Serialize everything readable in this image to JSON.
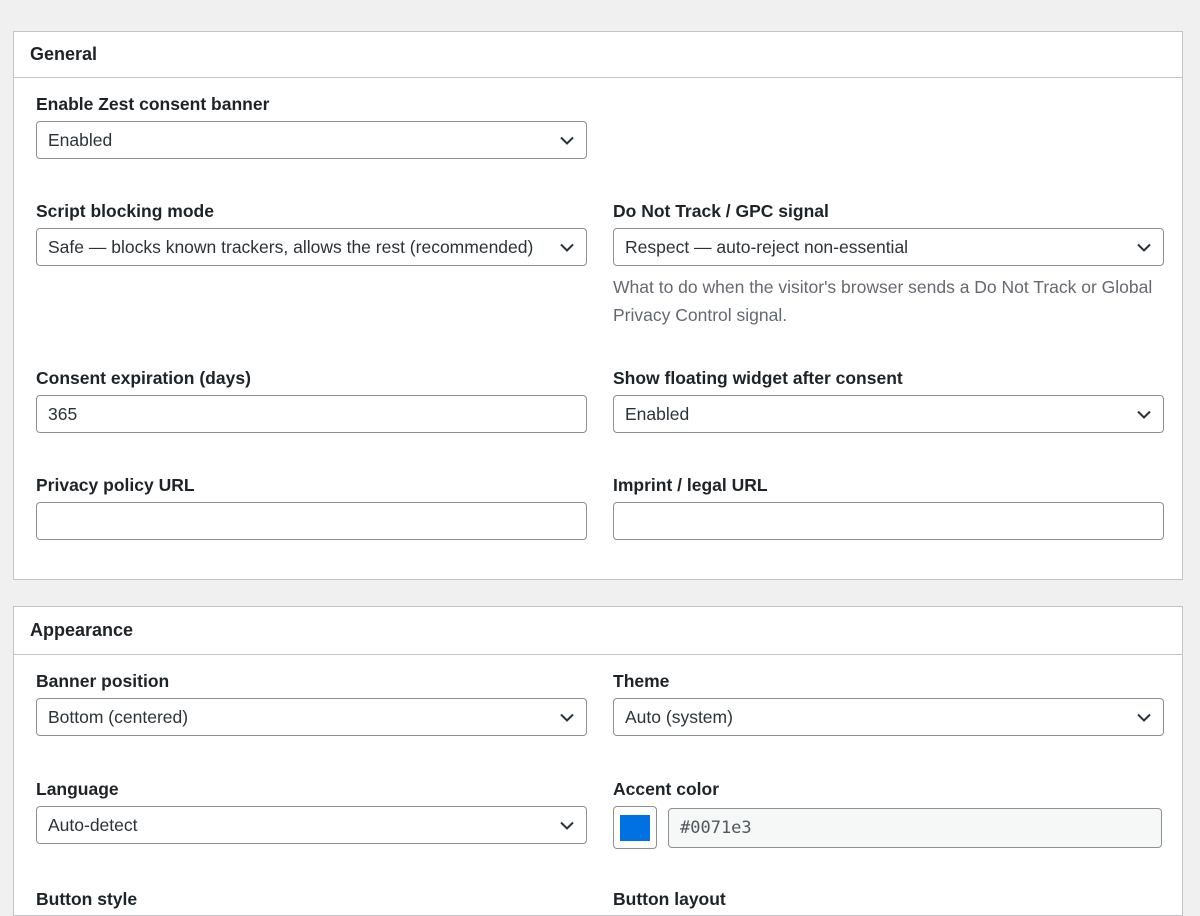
{
  "sections": {
    "general": {
      "title": "General",
      "fields": {
        "enable_banner": {
          "label": "Enable Zest consent banner",
          "value": "Enabled"
        },
        "script_blocking": {
          "label": "Script blocking mode",
          "value": "Safe — blocks known trackers, allows the rest (recommended)"
        },
        "dnt": {
          "label": "Do Not Track / GPC signal",
          "value": "Respect — auto-reject non-essential",
          "help": "What to do when the visitor's browser sends a Do Not Track or Global Privacy Control signal."
        },
        "expiration": {
          "label": "Consent expiration (days)",
          "value": "365"
        },
        "floating_widget": {
          "label": "Show floating widget after consent",
          "value": "Enabled"
        },
        "privacy_url": {
          "label": "Privacy policy URL",
          "value": ""
        },
        "imprint_url": {
          "label": "Imprint / legal URL",
          "value": ""
        }
      }
    },
    "appearance": {
      "title": "Appearance",
      "fields": {
        "banner_position": {
          "label": "Banner position",
          "value": "Bottom (centered)"
        },
        "theme": {
          "label": "Theme",
          "value": "Auto (system)"
        },
        "language": {
          "label": "Language",
          "value": "Auto-detect"
        },
        "accent_color": {
          "label": "Accent color",
          "value": "#0071e3"
        },
        "button_style": {
          "label": "Button style"
        },
        "button_layout": {
          "label": "Button layout"
        }
      }
    }
  },
  "colors": {
    "accent_swatch": "#0071e3",
    "page_bg": "#f0f0f1",
    "border": "#8c8f94"
  }
}
